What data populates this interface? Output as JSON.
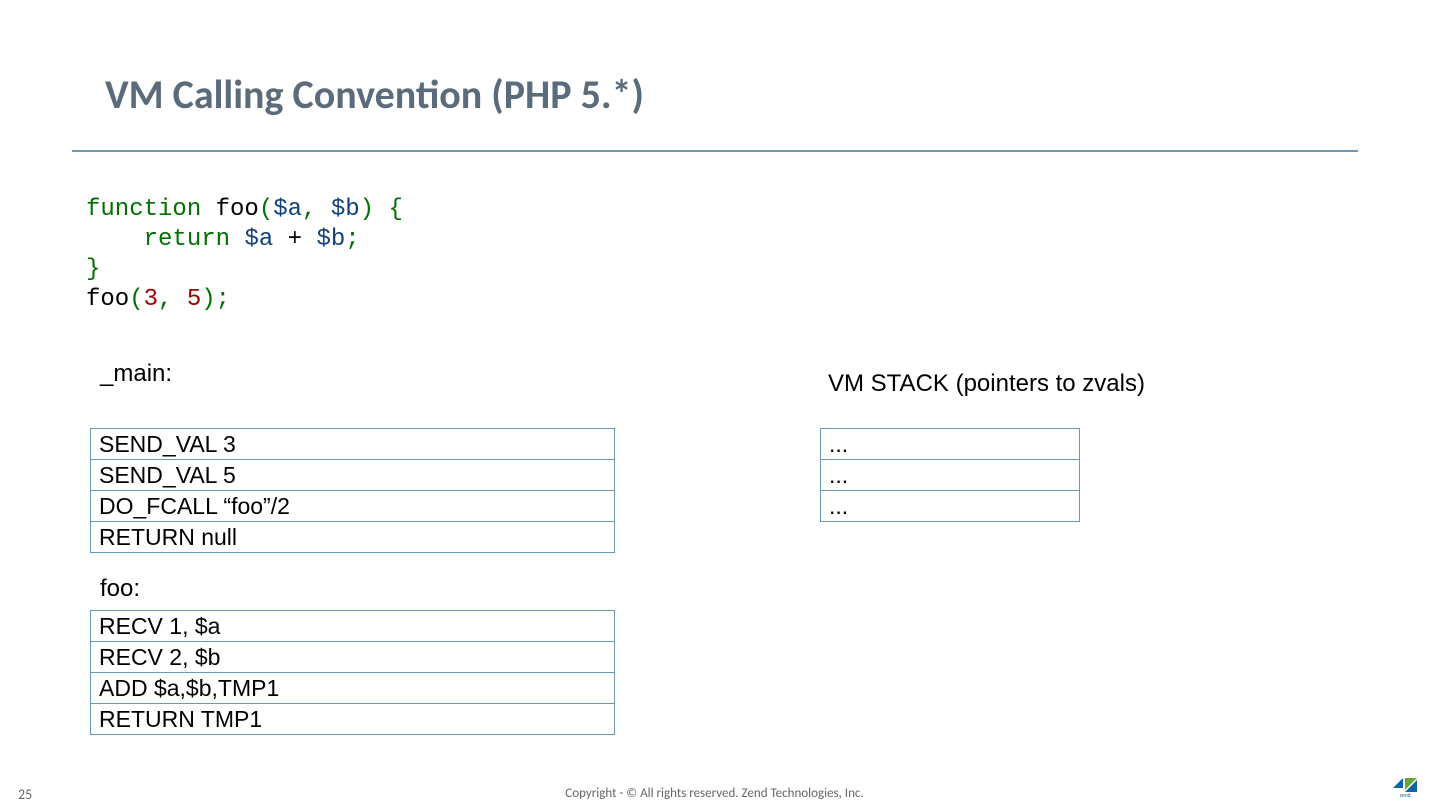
{
  "title": "VM Calling Convention (PHP 5.*)",
  "code": {
    "l1": {
      "kw1": "function",
      "name": " foo",
      "open": "(",
      "a": "$a",
      "c1": ", ",
      "b": "$b",
      "close": ") {"
    },
    "l2": {
      "indent": "    ",
      "kw": "return",
      "sp": " ",
      "a": "$a",
      "plus": " + ",
      "b": "$b",
      "semi": ";"
    },
    "l3": "}",
    "l4": {
      "name": "foo",
      "open": "(",
      "n1": "3",
      "c": ", ",
      "n2": "5",
      "close": ");"
    }
  },
  "labels": {
    "main": "_main:",
    "foo": "foo:",
    "stack": "VM STACK (pointers to zvals)"
  },
  "main_ops": [
    "SEND_VAL 3",
    "SEND_VAL 5",
    "DO_FCALL  “foo”/2",
    "RETURN null"
  ],
  "foo_ops": [
    "RECV 1, $a",
    "RECV 2, $b",
    "ADD $a,$b,TMP1",
    "RETURN TMP1"
  ],
  "stack": [
    "...",
    "...",
    "..."
  ],
  "footer": "Copyright - © All rights reserved. Zend Technologies, Inc.",
  "page": "25"
}
